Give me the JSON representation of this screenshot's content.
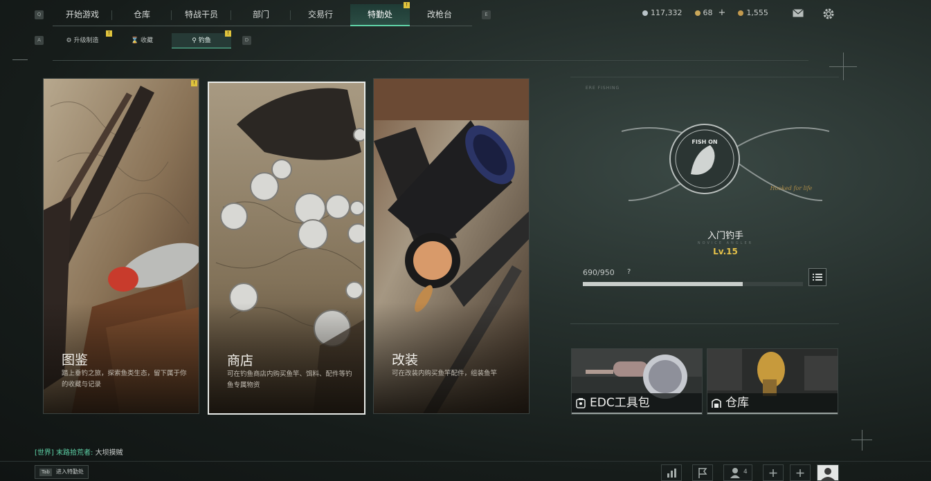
{
  "top_nav": {
    "left_key": "Q",
    "right_key": "E",
    "tabs": [
      {
        "label": "开始游戏",
        "active": false
      },
      {
        "label": "仓库",
        "active": false
      },
      {
        "label": "特战干员",
        "active": false
      },
      {
        "label": "部门",
        "active": false
      },
      {
        "label": "交易行",
        "active": false
      },
      {
        "label": "特勤处",
        "active": true,
        "badge": "!"
      },
      {
        "label": "改枪台",
        "active": false
      }
    ]
  },
  "currencies": [
    {
      "value": "117,332",
      "icon": "silver-coin-icon",
      "color": "#b9c3c8"
    },
    {
      "value": "68",
      "icon": "gold-coin-icon",
      "color": "#c9a75a",
      "plus": "+"
    },
    {
      "value": "1,555",
      "icon": "bronze-coin-icon",
      "color": "#c39a4e"
    }
  ],
  "header_icons": [
    "mail-icon",
    "settings-gear-icon"
  ],
  "sub_nav": {
    "left_key": "A",
    "right_key": "D",
    "tabs": [
      {
        "label": "升级制造",
        "icon": "gear-upgrade-icon",
        "badge": "!",
        "active": false
      },
      {
        "label": "收藏",
        "icon": "hourglass-icon",
        "active": false
      },
      {
        "label": "钓鱼",
        "icon": "fishing-rod-icon",
        "badge": "!",
        "active": true
      }
    ]
  },
  "cards": [
    {
      "title": "图鉴",
      "desc": "踏上垂钓之旅，探索鱼类生态，留下属于你的收藏与记录",
      "badge": "!"
    },
    {
      "title": "商店",
      "desc": "可在钓鱼商店内购买鱼竿、饵料、配件等钓鱼专属物资"
    },
    {
      "title": "改装",
      "desc": "可在改装内购买鱼竿配件，组装鱼竿"
    }
  ],
  "profile": {
    "brand": "ERE FISHING",
    "emblem_text": "FISH ON",
    "signature": "Hooked for life",
    "level_name": "入门钓手",
    "level_sub": "NOVICE ANGLER",
    "level": "Lv.15",
    "xp_current": 690,
    "xp_max": 950,
    "xp_text": "690/950",
    "xp_help": "?"
  },
  "tiles": [
    {
      "label": "EDC工具包",
      "icon": "toolkit-icon"
    },
    {
      "label": "仓库",
      "icon": "warehouse-icon"
    }
  ],
  "chat": {
    "channel": "[世界]",
    "user": "末路拾荒者:",
    "message": "大坝摸贼"
  },
  "tab_hint": {
    "key": "Tab",
    "label": "进入特勤处"
  },
  "bottom_bar": {
    "squad_count": "4",
    "icons": [
      "stats-chart-icon",
      "flag-icon",
      "squad-icon",
      "add-slot-icon",
      "add-slot-icon",
      "player-avatar"
    ]
  }
}
